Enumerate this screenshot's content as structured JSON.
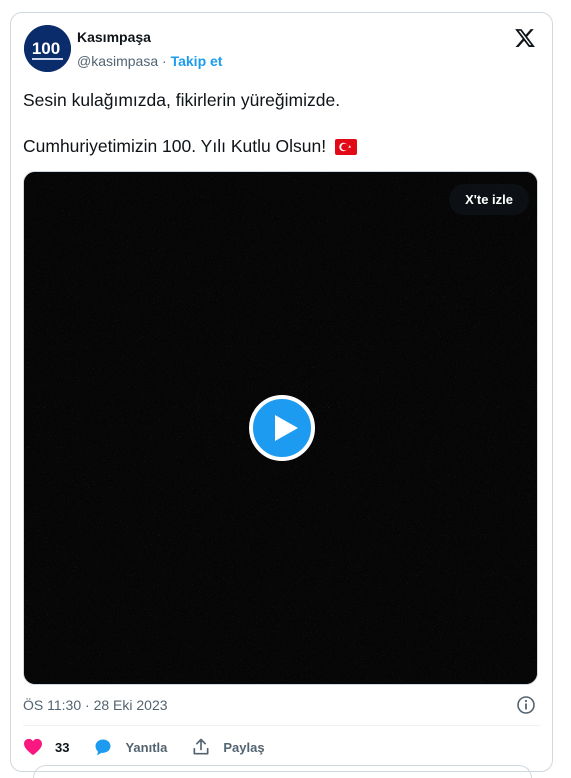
{
  "author": {
    "name": "Kasımpaşa",
    "handle": "@kasimpasa",
    "separator": " · ",
    "follow_label": "Takip et",
    "avatar_text": "100"
  },
  "tweet": {
    "line1": "Sesin kulağımızda, fikirlerin yüreğimizde.",
    "line2": "Cumhuriyetimizin 100. Yılı Kutlu Olsun!",
    "flag": "turkey-flag-emoji"
  },
  "video": {
    "watch_label": "X'te izle",
    "play_icon": "play-icon"
  },
  "meta": {
    "time": "ÖS 11:30",
    "separator": " · ",
    "date": "28 Eki 2023"
  },
  "actions": {
    "like_count": "33",
    "reply_label": "Yanıtla",
    "share_label": "Paylaş"
  },
  "colors": {
    "accent": "#1d9bf0",
    "like": "#f91880",
    "text": "#0f1419",
    "muted": "#536471"
  }
}
